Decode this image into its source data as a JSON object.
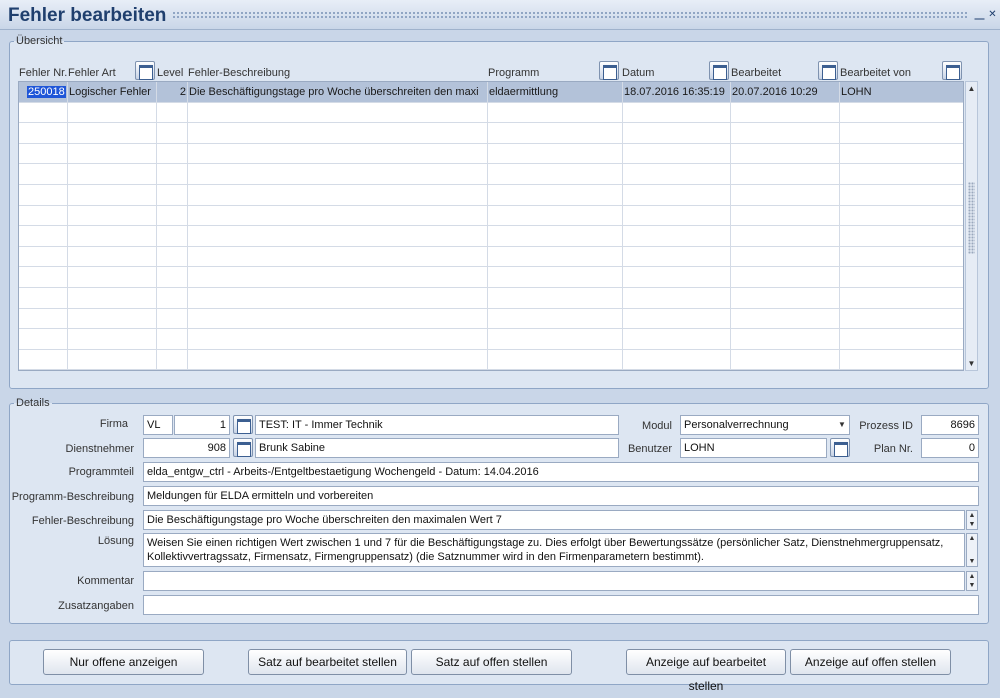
{
  "window": {
    "title": "Fehler bearbeiten",
    "minimize_glyph": "⎽",
    "close_glyph": "✕"
  },
  "overview": {
    "legend": "Übersicht",
    "columns": {
      "fehler_nr": "Fehler Nr.",
      "fehler_art": "Fehler Art",
      "level": "Level",
      "beschreibung": "Fehler-Beschreibung",
      "programm": "Programm",
      "datum": "Datum",
      "bearbeitet": "Bearbeitet",
      "bearbeitet_von": "Bearbeitet von"
    },
    "rows": [
      {
        "fehler_nr": "250018",
        "fehler_art": "Logischer Fehler",
        "level": "2",
        "beschreibung": "Die Beschäftigungstage pro Woche überschreiten den maxi",
        "programm": "eldaermittlung",
        "datum": "18.07.2016 16:35:19",
        "bearbeitet": "20.07.2016 10:29",
        "bearbeitet_von": "LOHN"
      }
    ],
    "scroll_up": "▲",
    "scroll_down": "▼"
  },
  "details": {
    "legend": "Details",
    "firma": {
      "label": "Firma",
      "code": "VL",
      "number": "1",
      "name": "TEST: IT - Immer Technik"
    },
    "modul": {
      "label": "Modul",
      "value": "Personalverrechnung",
      "arrow": "▼"
    },
    "prozess_id": {
      "label": "Prozess ID",
      "value": "8696"
    },
    "dienstnehmer": {
      "label": "Dienstnehmer",
      "number": "908",
      "name": "Brunk Sabine"
    },
    "benutzer": {
      "label": "Benutzer",
      "value": "LOHN"
    },
    "plan_nr": {
      "label": "Plan Nr.",
      "value": "0"
    },
    "programmteil": {
      "label": "Programmteil",
      "value": "elda_entgw_ctrl - Arbeits-/Entgeltbestaetigung Wochengeld - Datum: 14.04.2016"
    },
    "programm_beschreibung": {
      "label": "Programm-Beschreibung",
      "value": "Meldungen für ELDA ermitteln und vorbereiten"
    },
    "fehler_beschreibung": {
      "label": "Fehler-Beschreibung",
      "value": "Die Beschäftigungstage pro Woche überschreiten den maximalen Wert 7"
    },
    "loesung": {
      "label": "Lösung",
      "value": "Weisen Sie einen richtigen Wert zwischen 1 und 7 für die Beschäftigungstage zu. Dies erfolgt über Bewertungssätze (persönlicher Satz, Dienstnehmergruppensatz, Kollektivvertragssatz, Firmensatz, Firmengruppensatz) (die Satznummer wird in den Firmenparametern bestimmt)."
    },
    "kommentar": {
      "label": "Kommentar",
      "value": ""
    },
    "zusatzangaben": {
      "label": "Zusatzangaben",
      "value": ""
    },
    "spin_up": "▲",
    "spin_down": "▼"
  },
  "buttons": {
    "nur_offene": "Nur offene anzeigen",
    "satz_bearbeitet": "Satz auf bearbeitet stellen",
    "satz_offen": "Satz auf offen stellen",
    "anzeige_bearbeitet": "Anzeige auf bearbeitet stellen",
    "anzeige_offen": "Anzeige auf offen stellen"
  }
}
